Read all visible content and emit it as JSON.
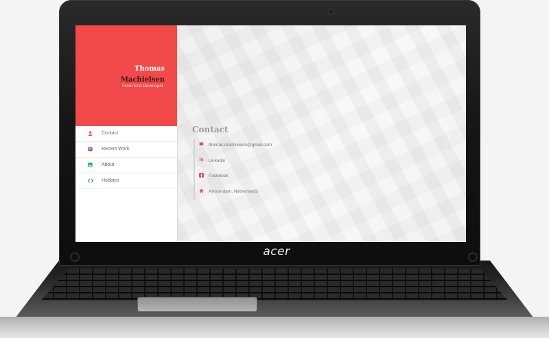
{
  "device": {
    "brand": "acer"
  },
  "profile": {
    "first_name": "Thomas",
    "last_name": "Machielsen",
    "role": "Front End Developer",
    "accent_color": "#f24a4a"
  },
  "nav": {
    "items": [
      {
        "label": "Contact",
        "icon": "user-icon",
        "color": "#e84c4c"
      },
      {
        "label": "Recent Work",
        "icon": "briefcase-icon",
        "color": "#8e44ad"
      },
      {
        "label": "About",
        "icon": "image-icon",
        "color": "#27ae60"
      },
      {
        "label": "Hobbies",
        "icon": "code-icon",
        "color": "#2980b9"
      }
    ]
  },
  "contact": {
    "title": "Contact",
    "items": [
      {
        "text": "thomas.machielsen@gmail.com",
        "icon": "chat-icon"
      },
      {
        "text": "Linkedin",
        "icon": "linkedin-icon"
      },
      {
        "text": "Facebook",
        "icon": "facebook-icon"
      },
      {
        "text": "Amsterdam, Netherlands",
        "icon": "home-icon"
      }
    ]
  }
}
